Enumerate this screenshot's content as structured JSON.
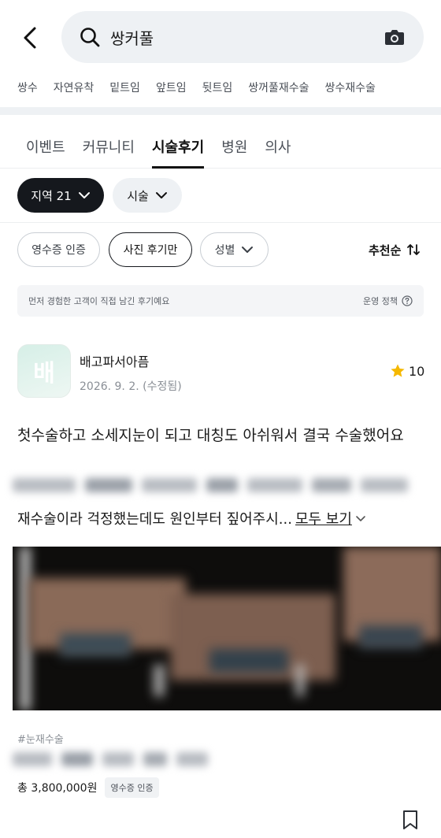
{
  "header": {
    "search_value": "쌍커풀",
    "icons": {
      "back": "chevron-left-icon",
      "search": "search-icon",
      "camera": "camera-icon"
    }
  },
  "related_keywords": [
    "쌍수",
    "자연유착",
    "밑트임",
    "앞트임",
    "뒷트임",
    "쌍꺼풀재수술",
    "쌍수재수술"
  ],
  "tabs": [
    {
      "label": "이벤트",
      "active": false
    },
    {
      "label": "커뮤니티",
      "active": false
    },
    {
      "label": "시술후기",
      "active": true
    },
    {
      "label": "병원",
      "active": false
    },
    {
      "label": "의사",
      "active": false
    }
  ],
  "filters": {
    "region_label": "지역 21",
    "treatment_label": "시술",
    "receipt_label": "영수증 인증",
    "photo_label": "사진 후기만",
    "gender_label": "성별",
    "sort_label": "추천순"
  },
  "notice": {
    "text": "먼저 경험한 고객이 직접 남긴 후기예요",
    "policy_label": "운영 정책"
  },
  "review": {
    "logo_char": "배",
    "hospital_name": "배고파서아픔",
    "date": "2026. 9. 2. (수정됨)",
    "rating": "10",
    "title": "첫수술하고 소세지눈이 되고 대칭도 아쉬워서 결국 수술했어요",
    "snippet": "재수술이라 걱정했는데도 원인부터 짚어주시...",
    "more_label": "모두 보기",
    "hashtag": "#눈재수술",
    "price": "총 3,800,000원",
    "receipt_badge": "영수증 인증"
  },
  "colors": {
    "accent_dark": "#15181d",
    "surface": "#eef1f4",
    "star": "#f5b800"
  }
}
